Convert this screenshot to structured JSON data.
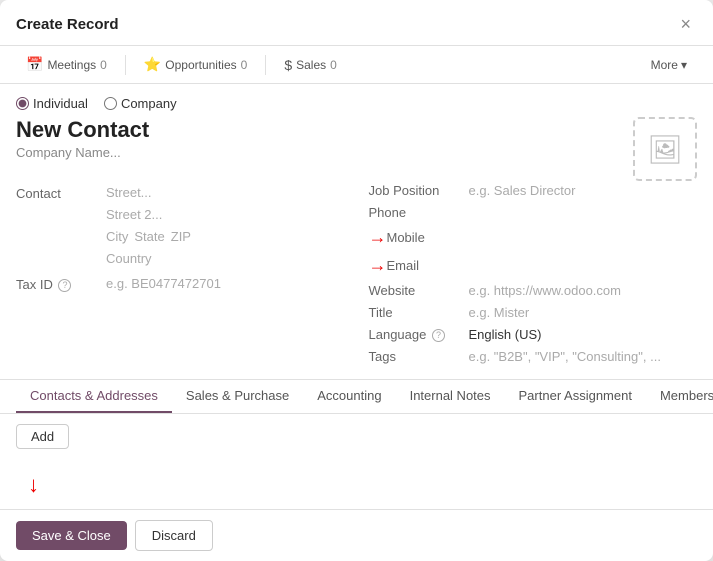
{
  "dialog": {
    "title": "Create Record",
    "close_label": "×"
  },
  "toolbar": {
    "meetings_label": "Meetings",
    "meetings_count": "0",
    "meetings_icon": "📅",
    "opportunities_label": "Opportunities",
    "opportunities_count": "0",
    "opportunities_icon": "⭐",
    "sales_label": "Sales",
    "sales_count": "0",
    "sales_icon": "$",
    "more_label": "More",
    "more_icon": "▾"
  },
  "form": {
    "type_individual": "Individual",
    "type_company": "Company",
    "contact_name": "New Contact",
    "company_name_placeholder": "Company Name...",
    "contact_label": "Contact",
    "street_placeholder": "Street...",
    "street2_placeholder": "Street 2...",
    "city_placeholder": "City",
    "state_placeholder": "State",
    "zip_placeholder": "ZIP",
    "country_placeholder": "Country",
    "tax_id_label": "Tax ID",
    "tax_id_help": "?",
    "tax_id_placeholder": "e.g. BE0477472701",
    "job_position_label": "Job Position",
    "job_position_placeholder": "e.g. Sales Director",
    "phone_label": "Phone",
    "mobile_label": "Mobile",
    "email_label": "Email",
    "website_label": "Website",
    "website_placeholder": "e.g. https://www.odoo.com",
    "title_label": "Title",
    "title_placeholder": "e.g. Mister",
    "language_label": "Language",
    "language_help": "?",
    "language_value": "English (US)",
    "tags_label": "Tags",
    "tags_placeholder": "e.g. \"B2B\", \"VIP\", \"Consulting\", ..."
  },
  "tabs": [
    {
      "id": "contacts",
      "label": "Contacts & Addresses",
      "active": true
    },
    {
      "id": "sales",
      "label": "Sales & Purchase",
      "active": false
    },
    {
      "id": "accounting",
      "label": "Accounting",
      "active": false
    },
    {
      "id": "notes",
      "label": "Internal Notes",
      "active": false
    },
    {
      "id": "assignment",
      "label": "Partner Assignment",
      "active": false
    },
    {
      "id": "membership",
      "label": "Membership",
      "active": false
    }
  ],
  "tab_content": {
    "add_button": "Add"
  },
  "footer": {
    "save_close_label": "Save & Close",
    "discard_label": "Discard"
  }
}
